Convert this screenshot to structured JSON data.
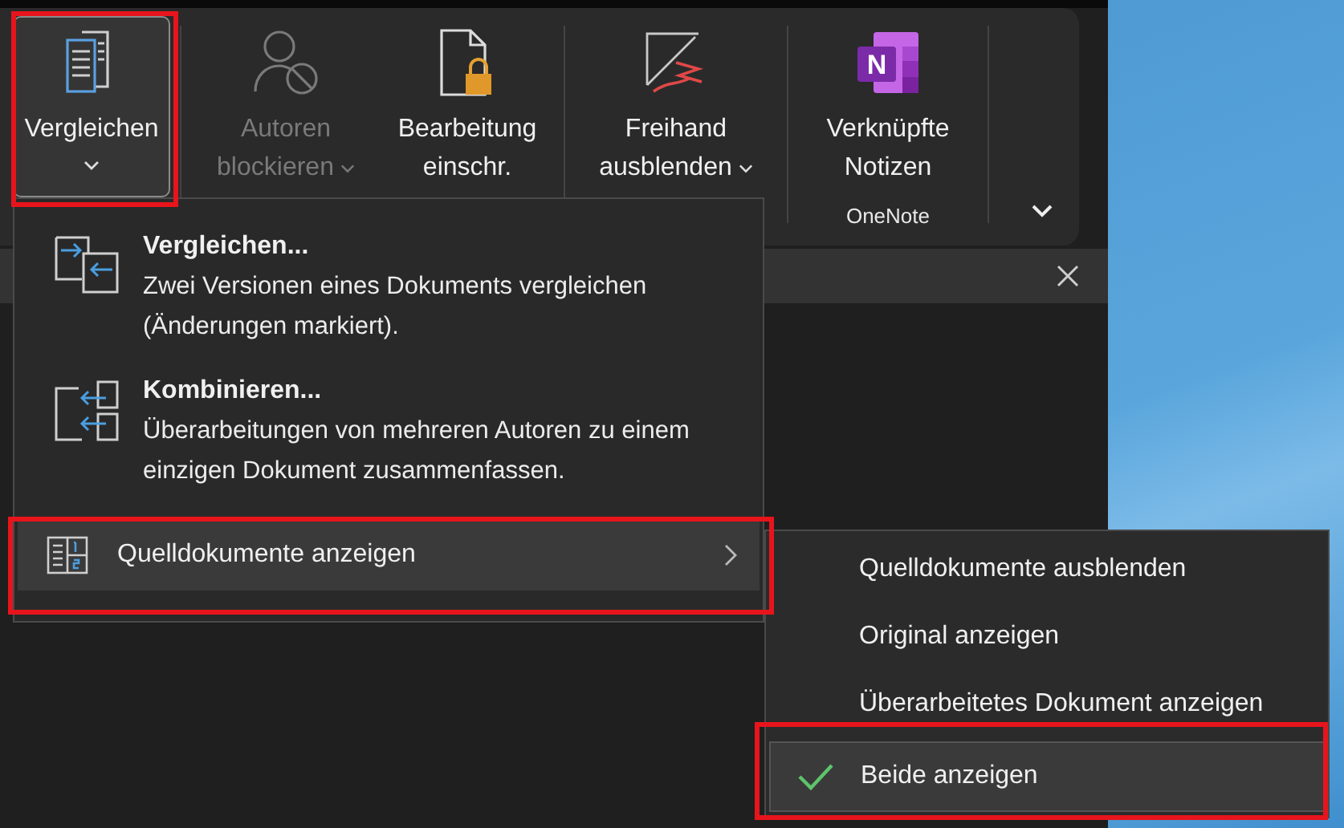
{
  "ribbon": {
    "buttons": [
      {
        "kind": "compare",
        "lines": [
          "Vergleichen"
        ],
        "dropdown": true,
        "disabled": false,
        "expanded": true
      },
      {
        "kind": "block-authors",
        "lines": [
          "Autoren",
          "blockieren"
        ],
        "dropdown": true,
        "disabled": true,
        "expanded": false
      },
      {
        "kind": "restrict-editing",
        "lines": [
          "Bearbeitung",
          "einschr."
        ],
        "dropdown": false,
        "disabled": false,
        "expanded": false
      },
      {
        "kind": "ink",
        "lines": [
          "Freihand",
          "ausblenden"
        ],
        "dropdown": true,
        "disabled": false,
        "expanded": false
      },
      {
        "kind": "onenote",
        "logo_letter": "N",
        "lines": [
          "Verknüpfte",
          "Notizen"
        ],
        "dropdown": false,
        "disabled": false,
        "expanded": false
      }
    ],
    "group_label": "OneNote"
  },
  "menu": {
    "items": [
      {
        "kind": "command",
        "title": "Vergleichen...",
        "description": "Zwei Versionen eines Dokuments vergleichen (Änderungen markiert).",
        "selected": false
      },
      {
        "kind": "command",
        "title": "Kombinieren...",
        "description": "Überarbeitungen von mehreren Autoren zu einem einzigen Dokument zusammenfassen.",
        "selected": false
      },
      {
        "kind": "submenu",
        "title": "Quelldokumente anzeigen",
        "selected": true
      }
    ]
  },
  "submenu": {
    "items": [
      {
        "label": "Quelldokumente ausblenden",
        "checked": false
      },
      {
        "label": "Original anzeigen",
        "checked": false
      },
      {
        "label": "Überarbeitetes Dokument anzeigen",
        "checked": false
      },
      {
        "label": "Beide anzeigen",
        "checked": true
      }
    ]
  }
}
